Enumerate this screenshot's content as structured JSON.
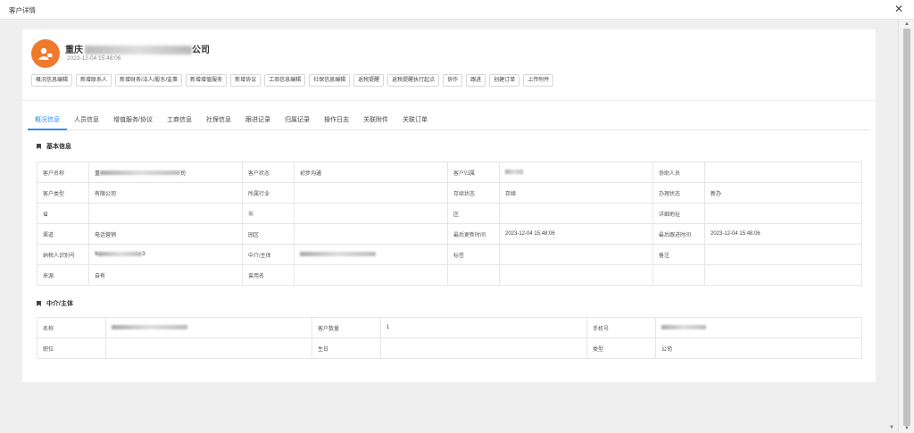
{
  "window": {
    "title": "客户详情"
  },
  "customer": {
    "name_visible": "重庆",
    "name_suffix": "公司",
    "created_at": "2023-12-04 15:48:06"
  },
  "actions": [
    "概况信息编辑",
    "新增联系人",
    "新增财务/法人/股东/监事",
    "新增增值服务",
    "新增协议",
    "工商信息编辑",
    "社保信息编辑",
    "返税提醒",
    "返税提醒执行起点",
    "协作",
    "跟进",
    "创建订单",
    "上传附件"
  ],
  "tabs": [
    "概况信息",
    "人员信息",
    "增值服务/协议",
    "工商信息",
    "社保信息",
    "跟进记录",
    "归属记录",
    "操作日志",
    "关联附件",
    "关联订单"
  ],
  "active_tab": 0,
  "basic": {
    "title": "基本信息",
    "rows": [
      [
        {
          "l": "客户名称",
          "v": "司",
          "mask": 90,
          "prefix": "重"
        },
        {
          "l": "客户状态",
          "v": "初步沟通"
        },
        {
          "l": "客户归属",
          "v": "",
          "mask": 20
        },
        {
          "l": "协助人员",
          "v": ""
        }
      ],
      [
        {
          "l": "客户类型",
          "v": "有限公司"
        },
        {
          "l": "所属行业",
          "v": ""
        },
        {
          "l": "存续状态",
          "v": "存续"
        },
        {
          "l": "办理状态",
          "v": "新办"
        }
      ],
      [
        {
          "l": "省",
          "v": ""
        },
        {
          "l": "市",
          "v": ""
        },
        {
          "l": "区",
          "v": ""
        },
        {
          "l": "详细地址",
          "v": ""
        }
      ],
      [
        {
          "l": "渠道",
          "v": "电话营销"
        },
        {
          "l": "园区",
          "v": ""
        },
        {
          "l": "最后更新时间",
          "v": "2023-12-04 15:48:06"
        },
        {
          "l": "最后跟进时间",
          "v": "2023-12-04 15:48:06"
        }
      ],
      [
        {
          "l": "纳税人识别号",
          "v": "3",
          "mask": 50,
          "prefix": "9"
        },
        {
          "l": "中介/主体",
          "v": "",
          "mask": 85
        },
        {
          "l": "标签",
          "v": ""
        },
        {
          "l": "备注",
          "v": ""
        }
      ],
      [
        {
          "l": "来源",
          "v": "自有"
        },
        {
          "l": "曾用名",
          "v": ""
        },
        {
          "l": "",
          "v": ""
        },
        {
          "l": "",
          "v": ""
        }
      ]
    ]
  },
  "agent": {
    "title": "中介/主体",
    "rows": [
      [
        {
          "l": "名称",
          "v": "",
          "mask": 85
        },
        {
          "l": "客户数量",
          "v": "1"
        },
        {
          "l": "手机号",
          "v": "",
          "mask": 50
        }
      ],
      [
        {
          "l": "职位",
          "v": ""
        },
        {
          "l": "生日",
          "v": ""
        },
        {
          "l": "类型",
          "v": "公司"
        }
      ]
    ]
  }
}
